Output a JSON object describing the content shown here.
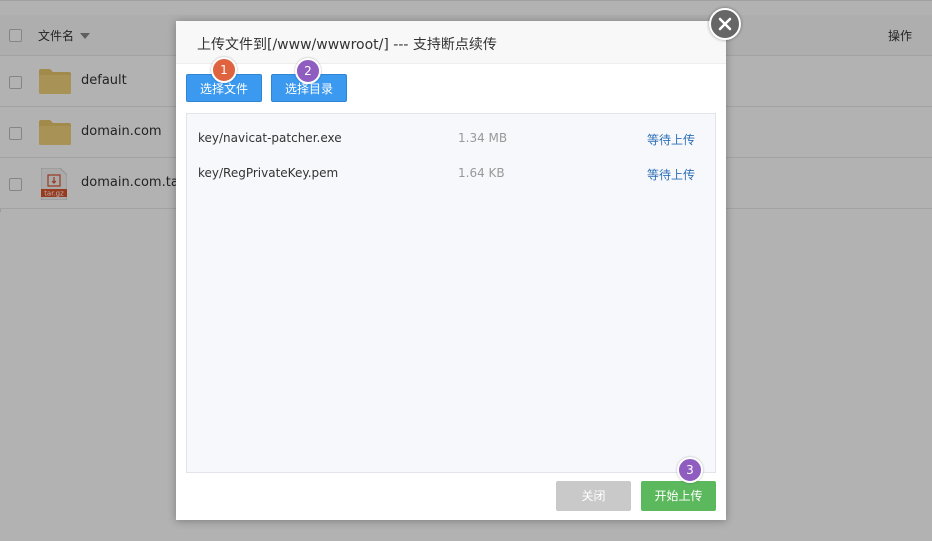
{
  "file_manager": {
    "header": {
      "name_label": "文件名",
      "ops_label": "操作"
    },
    "rows": [
      {
        "name": "default",
        "type": "folder"
      },
      {
        "name": "domain.com",
        "type": "folder"
      },
      {
        "name": "domain.com.tar.g",
        "type": "archive",
        "badge": "tar.gz"
      }
    ]
  },
  "modal": {
    "title": "上传文件到[/www/wwwroot/] --- 支持断点续传",
    "select_files_label": "选择文件",
    "select_dir_label": "选择目录",
    "files": [
      {
        "name": "key/navicat-patcher.exe",
        "size": "1.34 MB",
        "status": "等待上传"
      },
      {
        "name": "key/RegPrivateKey.pem",
        "size": "1.64 KB",
        "status": "等待上传"
      }
    ],
    "close_label": "关闭",
    "start_label": "开始上传"
  },
  "annotations": [
    {
      "label": "1",
      "color": "#e0633f"
    },
    {
      "label": "2",
      "color": "#8f5cc0"
    },
    {
      "label": "3",
      "color": "#8f5cc0"
    }
  ]
}
